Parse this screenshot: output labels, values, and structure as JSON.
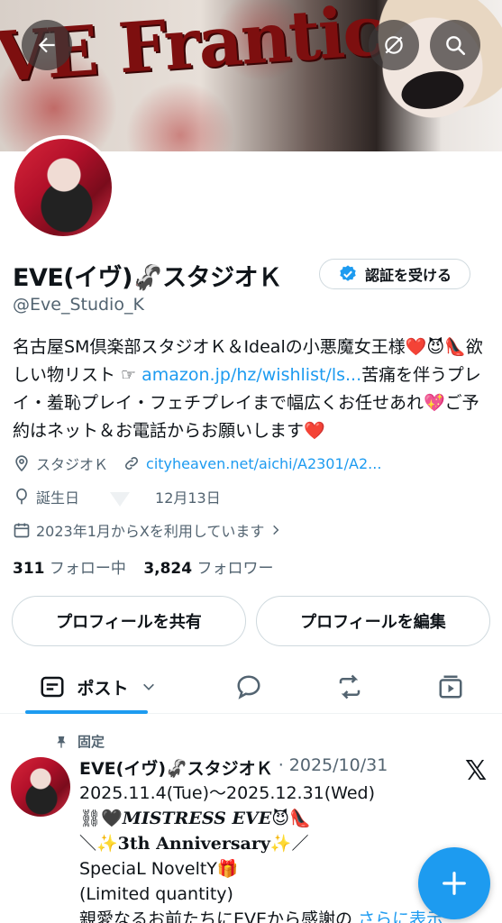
{
  "banner": {
    "title": "VE Frantic"
  },
  "profile": {
    "name": "EVE(イヴ)🦨スタジオＫ",
    "verify_label": "認証を受ける",
    "handle": "@Eve_Studio_K",
    "bio_part1": "名古屋SM倶楽部スタジオＫ＆Idealの小悪魔女王様❤️😈👠欲しい物リスト ☞ ",
    "bio_link": "amazon.jp/hz/wishlist/ls...",
    "bio_part2": "苦痛を伴うプレイ・羞恥プレイ・フェチプレイまで幅広くお任せあれ💖ご予約はネット＆お電話からお願いします❤️",
    "location": "スタジオＫ",
    "website": "cityheaven.net/aichi/A2301/A2...",
    "birthday_label": "誕生日",
    "birthday_value": "12月13日",
    "joined": "2023年1月からXを利用しています",
    "following_count": "311",
    "following_label": "フォロー中",
    "followers_count": "3,824",
    "followers_label": "フォロワー"
  },
  "buttons": {
    "share": "プロフィールを共有",
    "edit": "プロフィールを編集"
  },
  "tabs": {
    "posts": "ポスト"
  },
  "pinned_post": {
    "pinned_label": "固定",
    "author": "EVE(イヴ)🦨スタジオＫ",
    "date": "· 2025/10/31",
    "line1": "2025.11.4(Tue)〜2025.12.31(Wed)",
    "line2_prefix": "⛓🖤",
    "line2_serif": "MISTRESS EVE",
    "line2_suffix": "😈👠",
    "line3_prefix": "＼✨",
    "line3_serif": "3th Anniversary",
    "line3_suffix": "✨／",
    "line4": "SpeciaL NoveltY🎁",
    "line5": "(Limited quantity)",
    "line6": "親愛なるお前たちにEVEから感謝の",
    "more_label": "さらに表示"
  },
  "colors": {
    "accent": "#1d9bf0",
    "text": "#0f1419",
    "muted": "#536471",
    "border": "#cfd9de"
  }
}
